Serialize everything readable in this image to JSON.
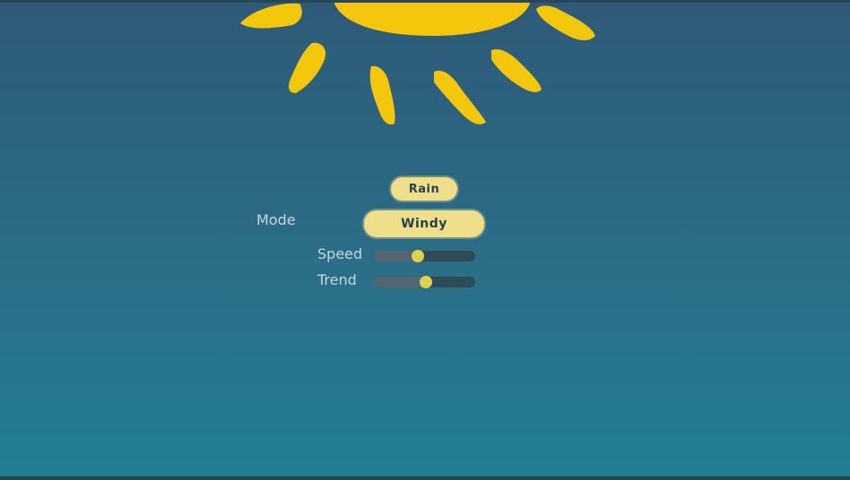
{
  "colors": {
    "sun": "#f4c60c",
    "pill_bg": "#f1de8a",
    "pill_text": "#23434f",
    "label_text": "#c9d4dc",
    "slider_track": "#2f4b56",
    "slider_fill": "#556670",
    "slider_knob": "#e3cf4e"
  },
  "icons": {
    "sun": "sun-icon"
  },
  "controls": {
    "main_button_label": "Rain",
    "mode_label": "Mode",
    "mode_value": "Windy",
    "sliders": [
      {
        "label": "Speed",
        "value": 0.44
      },
      {
        "label": "Trend",
        "value": 0.52
      }
    ]
  }
}
